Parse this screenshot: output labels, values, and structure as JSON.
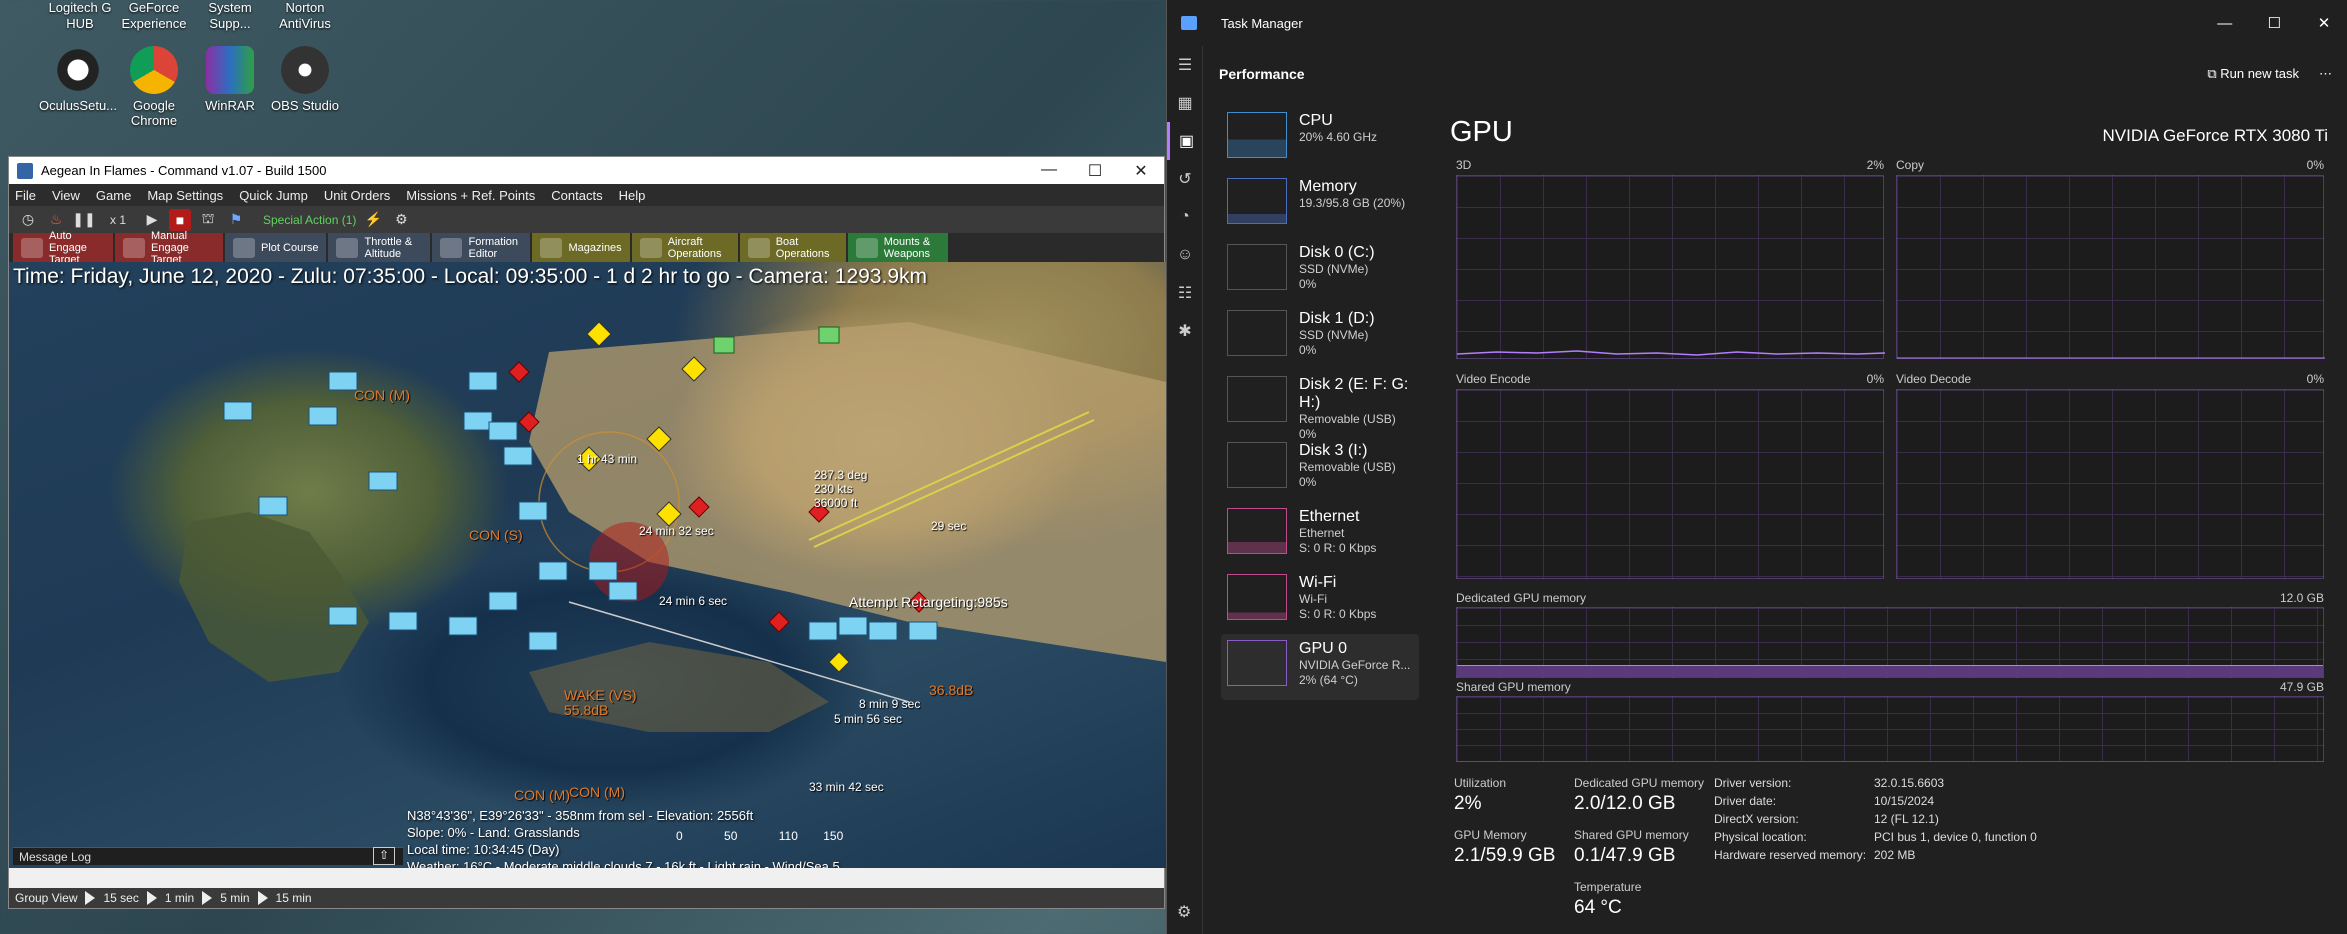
{
  "desktop": {
    "icons_top": [
      {
        "label": "Logitech G HUB"
      },
      {
        "label": "GeForce Experience"
      },
      {
        "label": "System Supp..."
      },
      {
        "label": "Norton AntiVirus"
      }
    ],
    "icons": [
      {
        "label": "OculusSetu..."
      },
      {
        "label": "Google Chrome"
      },
      {
        "label": "WinRAR"
      },
      {
        "label": "OBS Studio"
      }
    ]
  },
  "cmd": {
    "title": "Aegean In Flames - Command v1.07 - Build 1500",
    "menu": [
      "File",
      "View",
      "Game",
      "Map Settings",
      "Quick Jump",
      "Unit Orders",
      "Missions + Ref. Points",
      "Contacts",
      "Help"
    ],
    "speed": "x 1",
    "special_action": "Special Action (1)",
    "buttons": [
      {
        "label": "Auto Engage Target"
      },
      {
        "label": "Manual Engage Target"
      },
      {
        "label": "Plot Course"
      },
      {
        "label": "Throttle & Altitude"
      },
      {
        "label": "Formation Editor"
      },
      {
        "label": "Magazines"
      },
      {
        "label": "Aircraft Operations"
      },
      {
        "label": "Boat Operations"
      },
      {
        "label": "Mounts & Weapons"
      }
    ],
    "time_line": "Time: Friday, June 12, 2020 - Zulu: 07:35:00 - Local: 09:35:00 - 1 d 2 hr to go - Camera: 1293.9km",
    "info": {
      "line1": "N38°43'36\", E39°26'33\" - 358nm from sel - Elevation: 2556ft",
      "line2": "Slope: 0%  - Land: Grasslands",
      "line3": "Local time: 10:34:45 (Day)",
      "line4": "Weather: 16°C - Moderate middle clouds 7 - 16k ft - Light rain - Wind/Sea 5"
    },
    "scale_ticks": [
      "0",
      "50",
      "110",
      "150"
    ],
    "message_log": "Message Log",
    "bottom": {
      "group_view": "Group View",
      "steps": [
        "15 sec",
        "1 min",
        "5 min",
        "15 min"
      ]
    },
    "map_labels": [
      {
        "text": "CON (M)",
        "color": "#e07a2a"
      },
      {
        "text": "CON (S)",
        "color": "#e07a2a"
      },
      {
        "text": "WAKE (VS)",
        "color": "#e07a2a"
      },
      {
        "text": "55.8dB",
        "color": "#e07a2a"
      },
      {
        "text": "CON (M)",
        "color": "#e07a2a"
      },
      {
        "text": "CON (M)",
        "color": "#e07a2a"
      },
      {
        "text": "36.8dB",
        "color": "#e07a2a"
      },
      {
        "text": "1 hr 43 min",
        "color": "#ffffff"
      },
      {
        "text": "24 min 32 sec",
        "color": "#ffffff"
      },
      {
        "text": "24 min 6 sec",
        "color": "#ffffff"
      },
      {
        "text": "8 min 9 sec",
        "color": "#ffffff"
      },
      {
        "text": "5 min 56 sec",
        "color": "#ffffff"
      },
      {
        "text": "33 min 42 sec",
        "color": "#ffffff"
      },
      {
        "text": "Attempt Retargeting:985s",
        "color": "#ffffff"
      },
      {
        "text": "287.3 deg",
        "color": "#ffffff"
      },
      {
        "text": "230 kts",
        "color": "#ffffff"
      },
      {
        "text": "36000 ft",
        "color": "#ffffff"
      },
      {
        "text": "29 sec",
        "color": "#ffffff"
      }
    ]
  },
  "tm": {
    "title": "Task Manager",
    "section": "Performance",
    "run_new_task": "Run new task",
    "devices": [
      {
        "name": "CPU",
        "s1": "20% 4.60 GHz",
        "s2": ""
      },
      {
        "name": "Memory",
        "s1": "19.3/95.8 GB (20%)",
        "s2": ""
      },
      {
        "name": "Disk 0 (C:)",
        "s1": "SSD (NVMe)",
        "s2": "0%"
      },
      {
        "name": "Disk 1 (D:)",
        "s1": "SSD (NVMe)",
        "s2": "0%"
      },
      {
        "name": "Disk 2 (E: F: G: H:)",
        "s1": "Removable (USB)",
        "s2": "0%"
      },
      {
        "name": "Disk 3 (I:)",
        "s1": "Removable (USB)",
        "s2": "0%"
      },
      {
        "name": "Ethernet",
        "s1": "Ethernet",
        "s2": "S: 0 R: 0 Kbps"
      },
      {
        "name": "Wi-Fi",
        "s1": "Wi-Fi",
        "s2": "S: 0 R: 0 Kbps"
      },
      {
        "name": "GPU 0",
        "s1": "NVIDIA GeForce R...",
        "s2": "2% (64 °C)"
      }
    ],
    "gpu": {
      "title": "GPU",
      "model": "NVIDIA GeForce RTX 3080 Ti",
      "g3d": "3D",
      "g3d_pct": "2%",
      "copy": "Copy",
      "copy_pct": "0%",
      "venc": "Video Encode",
      "venc_pct": "0%",
      "vdec": "Video Decode",
      "vdec_pct": "0%",
      "ded_lbl": "Dedicated GPU memory",
      "ded_max": "12.0 GB",
      "sh_lbl": "Shared GPU memory",
      "sh_max": "47.9 GB",
      "util_lbl": "Utilization",
      "util_val": "2%",
      "dmem_lbl": "Dedicated GPU memory",
      "dmem_val": "2.0/12.0 GB",
      "gmem_lbl": "GPU Memory",
      "gmem_val": "2.1/59.9 GB",
      "smem_lbl": "Shared GPU memory",
      "smem_val": "0.1/47.9 GB",
      "temp_lbl": "Temperature",
      "temp_val": "64 °C",
      "details": [
        {
          "k": "Driver version:",
          "v": "32.0.15.6603"
        },
        {
          "k": "Driver date:",
          "v": "10/15/2024"
        },
        {
          "k": "DirectX version:",
          "v": "12 (FL 12.1)"
        },
        {
          "k": "Physical location:",
          "v": "PCI bus 1, device 0, function 0"
        },
        {
          "k": "Hardware reserved memory:",
          "v": "202 MB"
        }
      ]
    }
  }
}
